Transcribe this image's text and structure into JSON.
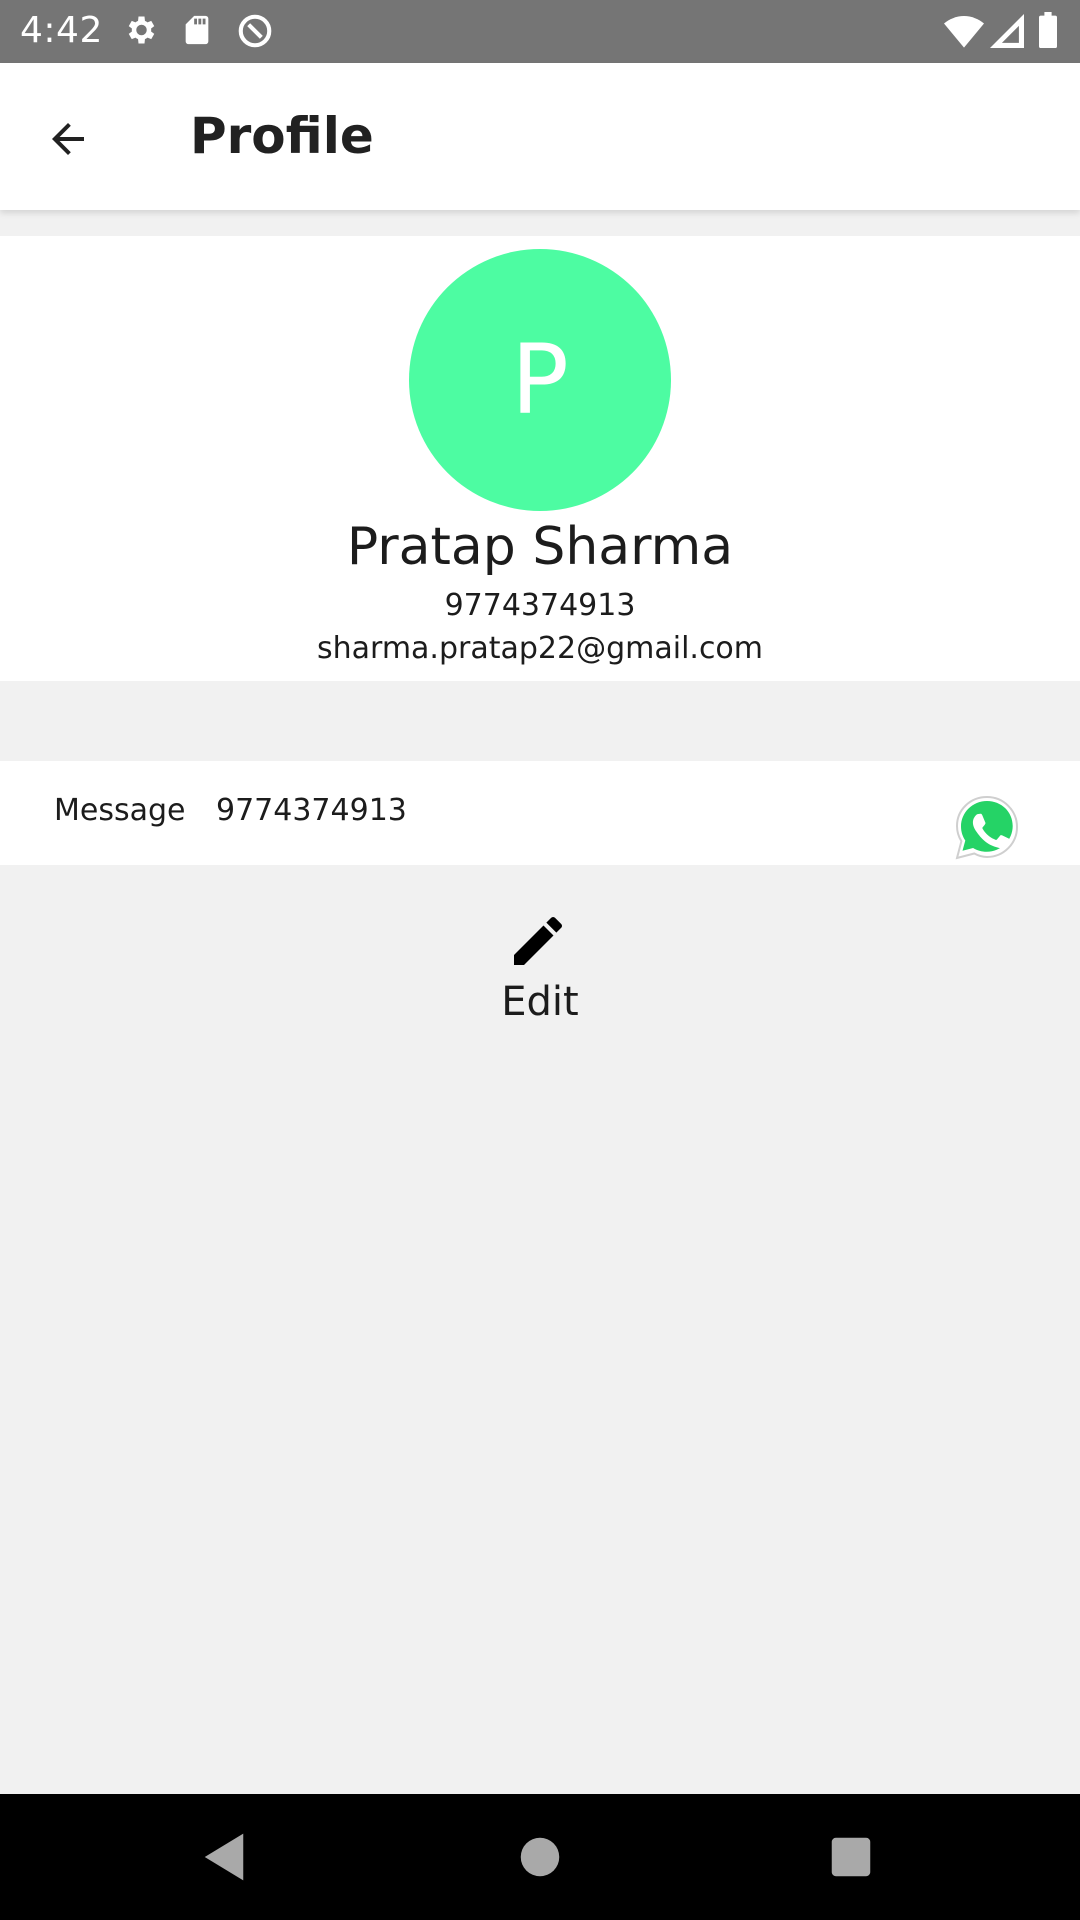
{
  "status_bar": {
    "time": "4:42",
    "icons_left": [
      "settings-icon",
      "sd-card-icon",
      "data-saver-icon"
    ],
    "icons_right": [
      "wifi-icon",
      "cell-signal-icon",
      "battery-icon"
    ]
  },
  "app_bar": {
    "title": "Profile",
    "back_icon": "arrow-back-icon"
  },
  "profile": {
    "avatar_initial": "P",
    "avatar_color": "#4dfca2",
    "name": "Pratap Sharma",
    "phone": "9774374913",
    "email": "sharma.pratap22@gmail.com"
  },
  "message_row": {
    "label": "Message",
    "number": "9774374913",
    "icon": "whatsapp-icon",
    "icon_color": "#25d366"
  },
  "edit": {
    "label": "Edit",
    "icon": "pencil-icon"
  },
  "nav_bar": {
    "buttons": [
      "back-triangle-icon",
      "home-circle-icon",
      "recents-square-icon"
    ]
  }
}
